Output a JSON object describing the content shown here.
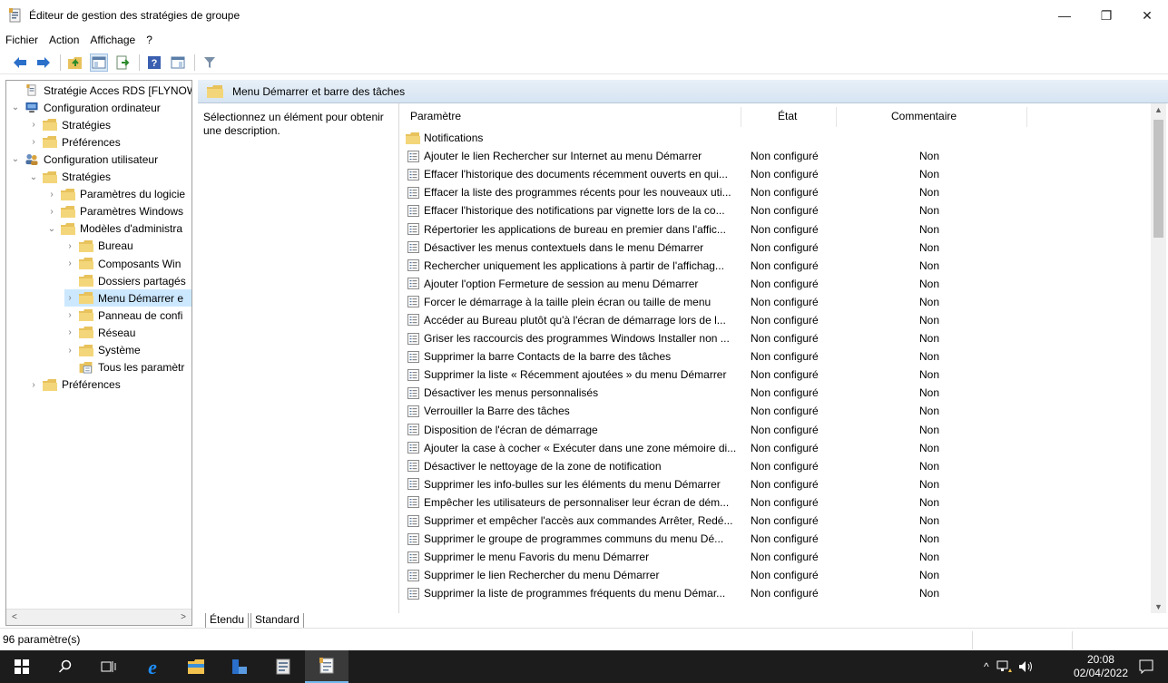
{
  "window": {
    "title": "Éditeur de gestion des stratégies de groupe",
    "minimize": "—",
    "maximize": "❐",
    "close": "✕"
  },
  "menu": [
    "Fichier",
    "Action",
    "Affichage",
    "?"
  ],
  "tree": [
    {
      "label": "Stratégie Acces RDS [FLYNOWSE",
      "icon": "policy-doc-icon",
      "level": 0,
      "chevron": ""
    },
    {
      "label": "Configuration ordinateur",
      "icon": "computer-icon",
      "level": 0,
      "chevron": "v"
    },
    {
      "label": "Stratégies",
      "icon": "folder-icon",
      "level": 1,
      "chevron": ">"
    },
    {
      "label": "Préférences",
      "icon": "folder-icon",
      "level": 1,
      "chevron": ">"
    },
    {
      "label": "Configuration utilisateur",
      "icon": "users-icon",
      "level": 0,
      "chevron": "v"
    },
    {
      "label": "Stratégies",
      "icon": "folder-icon",
      "level": 1,
      "chevron": "v"
    },
    {
      "label": "Paramètres du logicie",
      "icon": "folder-icon",
      "level": 2,
      "chevron": ">"
    },
    {
      "label": "Paramètres Windows",
      "icon": "folder-icon",
      "level": 2,
      "chevron": ">"
    },
    {
      "label": "Modèles d'administra",
      "icon": "folder-icon",
      "level": 2,
      "chevron": "v"
    },
    {
      "label": "Bureau",
      "icon": "folder-icon",
      "level": 3,
      "chevron": ">"
    },
    {
      "label": "Composants Win",
      "icon": "folder-icon",
      "level": 3,
      "chevron": ">"
    },
    {
      "label": "Dossiers partagés",
      "icon": "folder-icon",
      "level": 3,
      "chevron": ""
    },
    {
      "label": "Menu Démarrer e",
      "icon": "folder-icon",
      "level": 3,
      "chevron": ">",
      "selected": true
    },
    {
      "label": "Panneau de confi",
      "icon": "folder-icon",
      "level": 3,
      "chevron": ">"
    },
    {
      "label": "Réseau",
      "icon": "folder-icon",
      "level": 3,
      "chevron": ">"
    },
    {
      "label": "Système",
      "icon": "folder-icon",
      "level": 3,
      "chevron": ">"
    },
    {
      "label": "Tous les paramètr",
      "icon": "settings-folder-icon",
      "level": 3,
      "chevron": ""
    },
    {
      "label": "Préférences",
      "icon": "folder-icon",
      "level": 1,
      "chevron": ">"
    }
  ],
  "right_header": "Menu Démarrer et barre des tâches",
  "description": "Sélectionnez un élément pour obtenir une description.",
  "columns": {
    "param": "Paramètre",
    "state": "État",
    "comment": "Commentaire"
  },
  "folder_row": "Notifications",
  "rows": [
    {
      "name": "Ajouter le lien Rechercher sur Internet au menu Démarrer",
      "state": "Non configuré",
      "comment": "Non"
    },
    {
      "name": "Effacer l'historique des documents récemment ouverts en qui...",
      "state": "Non configuré",
      "comment": "Non"
    },
    {
      "name": "Effacer la liste des programmes récents pour les nouveaux uti...",
      "state": "Non configuré",
      "comment": "Non"
    },
    {
      "name": "Effacer l'historique des notifications par vignette lors de la co...",
      "state": "Non configuré",
      "comment": "Non"
    },
    {
      "name": "Répertorier les applications de bureau en premier dans l'affic...",
      "state": "Non configuré",
      "comment": "Non"
    },
    {
      "name": "Désactiver les menus contextuels dans le menu Démarrer",
      "state": "Non configuré",
      "comment": "Non"
    },
    {
      "name": "Rechercher uniquement les applications à partir de l'affichag...",
      "state": "Non configuré",
      "comment": "Non"
    },
    {
      "name": "Ajouter l'option Fermeture de session au menu Démarrer",
      "state": "Non configuré",
      "comment": "Non"
    },
    {
      "name": "Forcer le démarrage à la taille plein écran ou taille de menu",
      "state": "Non configuré",
      "comment": "Non"
    },
    {
      "name": "Accéder au Bureau plutôt qu'à l'écran de démarrage lors de l...",
      "state": "Non configuré",
      "comment": "Non"
    },
    {
      "name": "Griser les raccourcis des programmes Windows Installer non ...",
      "state": "Non configuré",
      "comment": "Non"
    },
    {
      "name": "Supprimer la barre Contacts de la barre des tâches",
      "state": "Non configuré",
      "comment": "Non"
    },
    {
      "name": "Supprimer la liste « Récemment ajoutées » du menu Démarrer",
      "state": "Non configuré",
      "comment": "Non"
    },
    {
      "name": "Désactiver les menus personnalisés",
      "state": "Non configuré",
      "comment": "Non"
    },
    {
      "name": "Verrouiller la Barre des tâches",
      "state": "Non configuré",
      "comment": "Non"
    },
    {
      "name": "Disposition de l'écran de démarrage",
      "state": "Non configuré",
      "comment": "Non"
    },
    {
      "name": "Ajouter la case à cocher « Exécuter dans une zone mémoire di...",
      "state": "Non configuré",
      "comment": "Non"
    },
    {
      "name": "Désactiver le nettoyage de la zone de notification",
      "state": "Non configuré",
      "comment": "Non"
    },
    {
      "name": "Supprimer les info-bulles sur les éléments du menu Démarrer",
      "state": "Non configuré",
      "comment": "Non"
    },
    {
      "name": "Empêcher les utilisateurs de personnaliser leur écran de dém...",
      "state": "Non configuré",
      "comment": "Non"
    },
    {
      "name": "Supprimer et empêcher l'accès aux commandes Arrêter, Redé...",
      "state": "Non configuré",
      "comment": "Non"
    },
    {
      "name": "Supprimer le groupe de programmes communs du menu Dé...",
      "state": "Non configuré",
      "comment": "Non"
    },
    {
      "name": "Supprimer le menu Favoris du menu Démarrer",
      "state": "Non configuré",
      "comment": "Non"
    },
    {
      "name": "Supprimer le lien Rechercher du menu Démarrer",
      "state": "Non configuré",
      "comment": "Non"
    },
    {
      "name": "Supprimer la liste de programmes fréquents du menu Démar...",
      "state": "Non configuré",
      "comment": "Non"
    }
  ],
  "tabs": {
    "extended": "Étendu",
    "standard": "Standard"
  },
  "status": "96 paramètre(s)",
  "clock": {
    "time": "20:08",
    "date": "02/04/2022"
  },
  "colors": {
    "accent": "#0078d7",
    "selection": "#cce8ff",
    "taskbar": "#1c1c1c",
    "folder": "#e8c25c"
  }
}
